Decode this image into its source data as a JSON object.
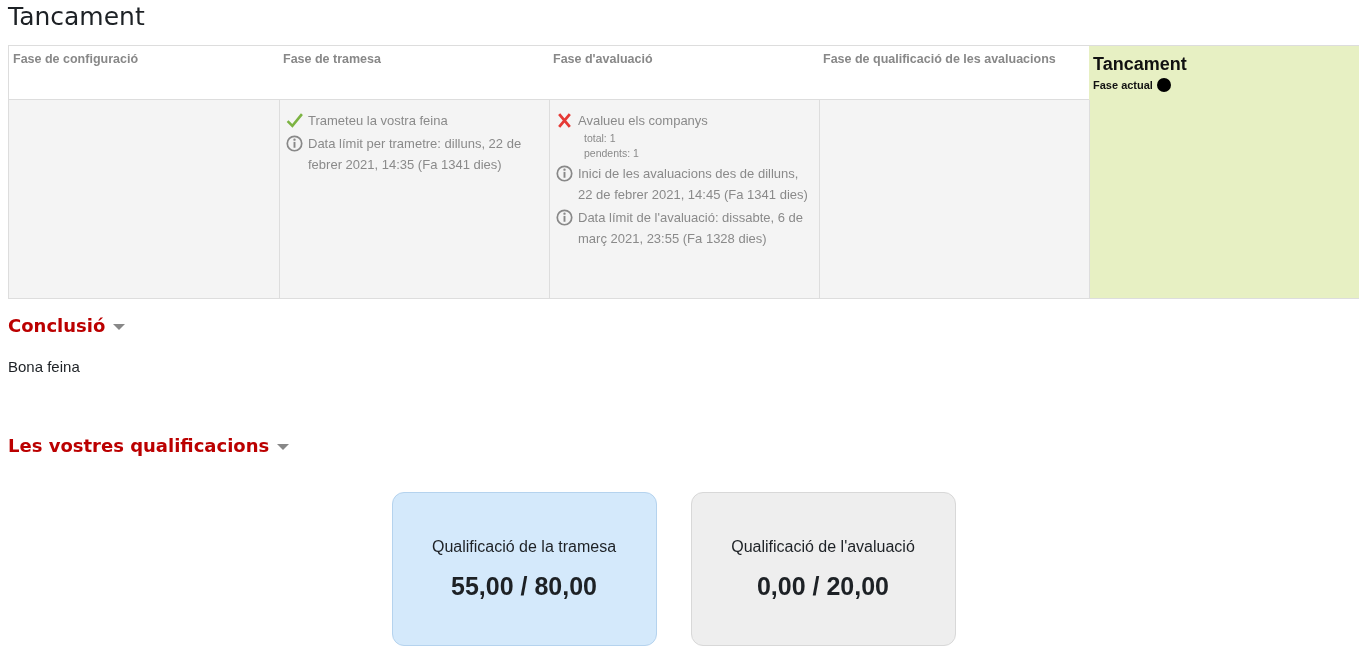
{
  "title": "Tancament",
  "phases": [
    {
      "title": "Fase de configuració",
      "selected": false
    },
    {
      "title": "Fase de tramesa",
      "selected": false,
      "tasks": [
        {
          "kind": "done",
          "text": "Trameteu la vostra feina"
        },
        {
          "kind": "info",
          "text": "Data límit per trametre: dilluns, 22 de febrer 2021, 14:35 (Fa 1341 dies)"
        }
      ]
    },
    {
      "title": "Fase d'avaluació",
      "selected": false,
      "tasks": [
        {
          "kind": "fail",
          "text": "Avalueu els companys",
          "details": [
            "total: 1",
            "pendents: 1"
          ]
        },
        {
          "kind": "info",
          "text": "Inici de les avaluacions des de dilluns, 22 de febrer 2021, 14:45 (Fa 1341 dies)"
        },
        {
          "kind": "info",
          "text": "Data límit de l'avaluació: dissabte, 6 de març 2021, 23:55 (Fa 1328 dies)"
        }
      ]
    },
    {
      "title": "Fase de qualificació de les avaluacions",
      "selected": false
    },
    {
      "title": "Tancament",
      "selected": true,
      "current_label": "Fase actual"
    }
  ],
  "conclusion": {
    "heading": "Conclusió",
    "text": "Bona feina"
  },
  "grades": {
    "heading": "Les vostres qualificacions",
    "cards": [
      {
        "kind": "submission",
        "label": "Qualificació de la tramesa",
        "value": "55,00 / 80,00"
      },
      {
        "kind": "assessment",
        "label": "Qualificació de l'avaluació",
        "value": "0,00 / 20,00"
      }
    ]
  }
}
